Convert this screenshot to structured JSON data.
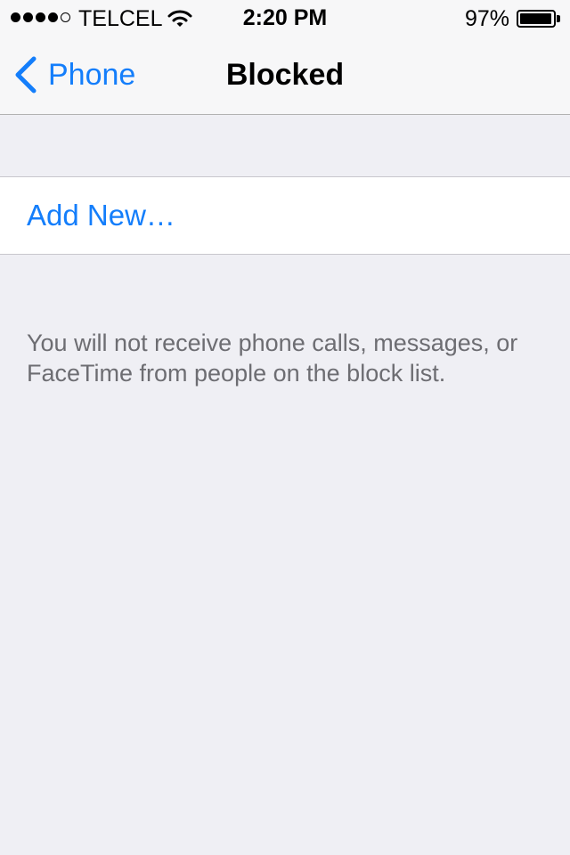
{
  "status_bar": {
    "carrier": "TELCEL",
    "time": "2:20 PM",
    "battery_percent": "97%",
    "battery_level": 0.97,
    "signal_bars_filled": 4,
    "signal_bars_total": 5,
    "wifi_icon": "wifi-icon"
  },
  "nav": {
    "back_label": "Phone",
    "title": "Blocked",
    "back_icon": "chevron-left-icon"
  },
  "list": {
    "add_label": "Add New…"
  },
  "footer": {
    "note": "You will not receive phone calls, messages, or FaceTime from people on the block list."
  },
  "colors": {
    "accent": "#147efb",
    "background": "#efeff4",
    "footer_text": "#6d6d72"
  }
}
